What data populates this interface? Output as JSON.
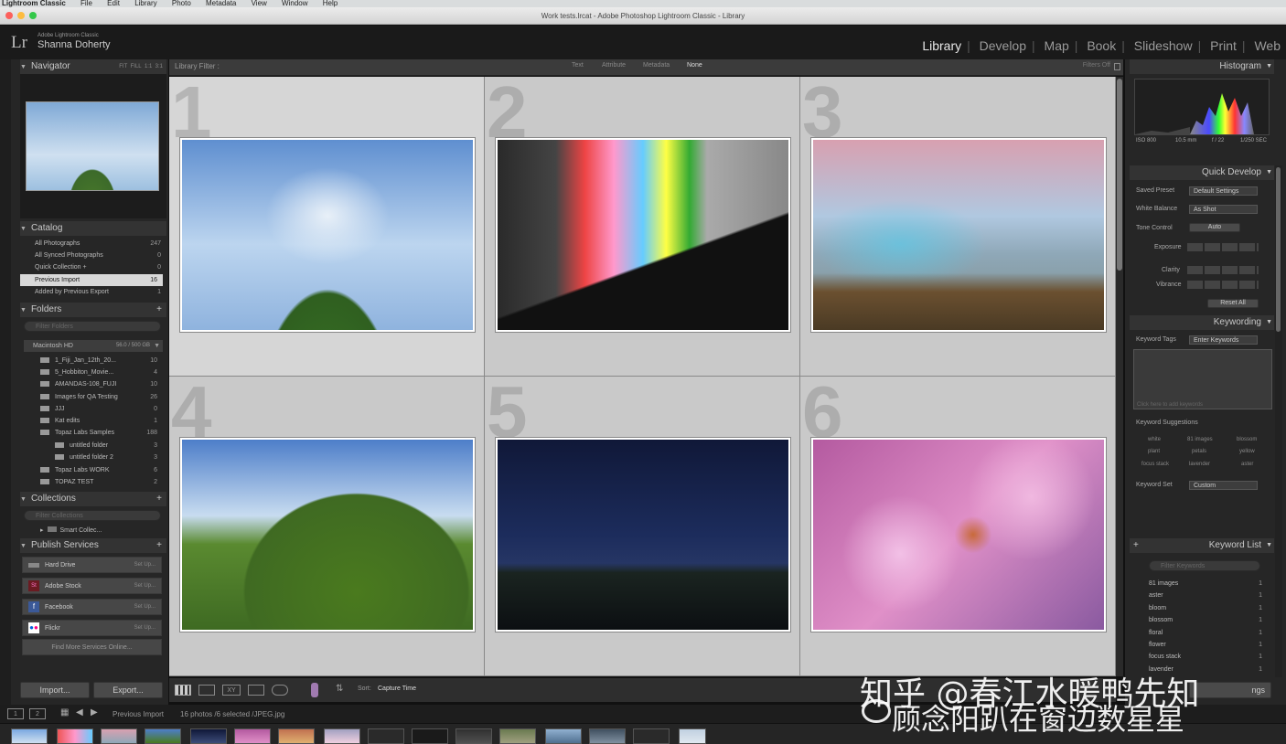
{
  "menubar": {
    "app": "Lightroom Classic",
    "items": [
      "File",
      "Edit",
      "Library",
      "Photo",
      "Metadata",
      "View",
      "Window",
      "Help"
    ]
  },
  "window_title": "Work tests.lrcat - Adobe Photoshop Lightroom Classic - Library",
  "identity": {
    "logo": "Lr",
    "app": "Adobe Lightroom Classic",
    "user": "Shanna Doherty"
  },
  "modules": [
    "Library",
    "Develop",
    "Map",
    "Book",
    "Slideshow",
    "Print",
    "Web"
  ],
  "active_module": "Library",
  "navigator": {
    "title": "Navigator",
    "zoom": [
      "FIT",
      "FILL",
      "1:1",
      "3:1"
    ]
  },
  "catalog": {
    "title": "Catalog",
    "items": [
      {
        "label": "All Photographs",
        "count": "247"
      },
      {
        "label": "All Synced Photographs",
        "count": "0"
      },
      {
        "label": "Quick Collection +",
        "count": "0"
      },
      {
        "label": "Previous Import",
        "count": "16"
      },
      {
        "label": "Added by Previous Export",
        "count": "1"
      }
    ]
  },
  "folders": {
    "title": "Folders",
    "search_placeholder": "Filter Folders",
    "volume": "Macintosh HD",
    "volume_size": "56.0 / 500 GB",
    "items": [
      {
        "label": "1_Fiji_Jan_12th_20...",
        "count": "10"
      },
      {
        "label": "5_Hobbiton_Movie...",
        "count": "4"
      },
      {
        "label": "AMANDAS-108_FUJI",
        "count": "10"
      },
      {
        "label": "Images for QA Testing",
        "count": "26"
      },
      {
        "label": "JJJ",
        "count": "0"
      },
      {
        "label": "Kat edits",
        "count": "1"
      },
      {
        "label": "Topaz Labs Samples",
        "count": "188"
      },
      {
        "label": "untitled folder",
        "count": "3"
      },
      {
        "label": "untitled folder 2",
        "count": "3"
      },
      {
        "label": "Topaz Labs WORK",
        "count": "6"
      },
      {
        "label": "TOPAZ TEST",
        "count": "2"
      }
    ]
  },
  "collections": {
    "title": "Collections",
    "search_placeholder": "Filter Collections",
    "items": [
      {
        "label": "Smart Collec..."
      }
    ]
  },
  "publish": {
    "title": "Publish Services",
    "setup": "Set Up...",
    "items": [
      "Hard Drive",
      "Adobe Stock",
      "Facebook",
      "Flickr"
    ],
    "find_more": "Find More Services Online..."
  },
  "import_label": "Import...",
  "export_label": "Export...",
  "filter": {
    "label": "Library Filter :",
    "tabs": [
      "Text",
      "Attribute",
      "Metadata",
      "None"
    ],
    "status": "Filters Off"
  },
  "cells": [
    {
      "num": "1"
    },
    {
      "num": "2"
    },
    {
      "num": "3"
    },
    {
      "num": "4"
    },
    {
      "num": "5"
    },
    {
      "num": "6"
    }
  ],
  "histogram": {
    "title": "Histogram",
    "iso": "ISO 800",
    "focal": "10.5 mm",
    "aperture": "f / 22",
    "shutter": "1/250 SEC"
  },
  "quick_develop": {
    "title": "Quick Develop",
    "saved_preset": "Saved Preset",
    "preset_value": "Default Settings",
    "white_balance": "White Balance",
    "wb_value": "As Shot",
    "tone_control": "Tone Control",
    "auto": "Auto",
    "exposure": "Exposure",
    "clarity": "Clarity",
    "vibrance": "Vibrance",
    "reset": "Reset All"
  },
  "keywording": {
    "title": "Keywording",
    "tags_label": "Keyword Tags",
    "tags_value": "Enter Keywords",
    "click_hint": "Click here to add keywords",
    "suggestions_label": "Keyword Suggestions",
    "suggestions": [
      "white",
      "81 images",
      "blossom",
      "plant",
      "petals",
      "yellow",
      "focus stack",
      "lavender",
      "aster"
    ],
    "set_label": "Keyword Set",
    "set_value": "Custom"
  },
  "keyword_list": {
    "title": "Keyword List",
    "search_placeholder": "Filter Keywords",
    "items": [
      {
        "label": "81 images",
        "count": "1"
      },
      {
        "label": "aster",
        "count": "1"
      },
      {
        "label": "bloom",
        "count": "1"
      },
      {
        "label": "blossom",
        "count": "1"
      },
      {
        "label": "floral",
        "count": "1"
      },
      {
        "label": "flower",
        "count": "1"
      },
      {
        "label": "focus stack",
        "count": "1"
      },
      {
        "label": "lavender",
        "count": "1"
      }
    ]
  },
  "toolbar": {
    "sort_label": "Sort:",
    "sort_value": "Capture Time",
    "sync": "ngs"
  },
  "filmbar": {
    "pages": [
      "1",
      "2"
    ],
    "source": "Previous Import",
    "info": "16 photos /6 selected /JPEG.jpg"
  },
  "watermark": {
    "line1": "知乎 @春江水暖鸭先知",
    "line2": "顾念阳趴在窗边数星星"
  }
}
